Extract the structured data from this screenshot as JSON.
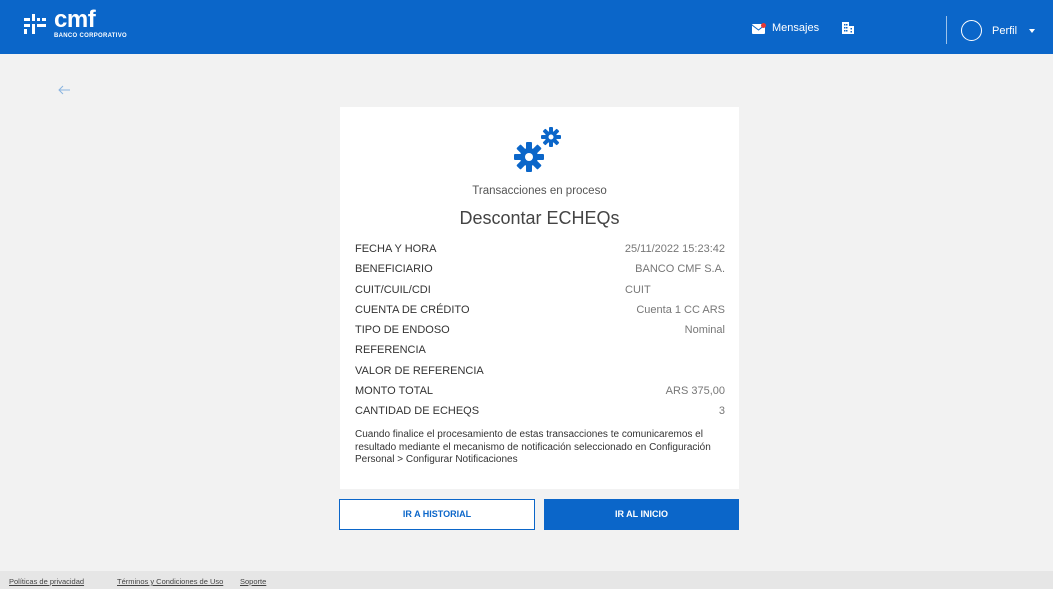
{
  "header": {
    "logo_name": "cmf",
    "logo_sub": "BANCO CORPORATIVO",
    "messages_label": "Mensajes",
    "profile_label": "Perfil",
    "brand_color": "#0b66c9"
  },
  "card": {
    "status": "Transacciones en proceso",
    "title": "Descontar ECHEQs",
    "rows": [
      {
        "key": "FECHA Y HORA",
        "value": "25/11/2022 15:23:42"
      },
      {
        "key": "BENEFICIARIO",
        "value": "BANCO CMF S.A."
      },
      {
        "key": "CUIT/CUIL/CDI",
        "value": "CUIT"
      },
      {
        "key": "CUENTA DE CRÉDITO",
        "value": "Cuenta 1 CC ARS"
      },
      {
        "key": "TIPO DE ENDOSO",
        "value": "Nominal"
      },
      {
        "key": "REFERENCIA",
        "value": ""
      },
      {
        "key": "VALOR DE REFERENCIA",
        "value": ""
      },
      {
        "key": "MONTO TOTAL",
        "value": "ARS 375,00"
      },
      {
        "key": "CANTIDAD DE ECHEQS",
        "value": "3"
      }
    ],
    "note": "Cuando finalice el procesamiento de estas transacciones te comunicaremos el resultado mediante el mecanismo de notificación seleccionado en Configuración Personal > Configurar Notificaciones"
  },
  "buttons": {
    "history": "IR A HISTORIAL",
    "home": "IR AL INICIO"
  },
  "footer": {
    "privacy": "Políticas de privacidad",
    "terms": "Términos y Condiciones de Uso",
    "support": "Soporte"
  }
}
